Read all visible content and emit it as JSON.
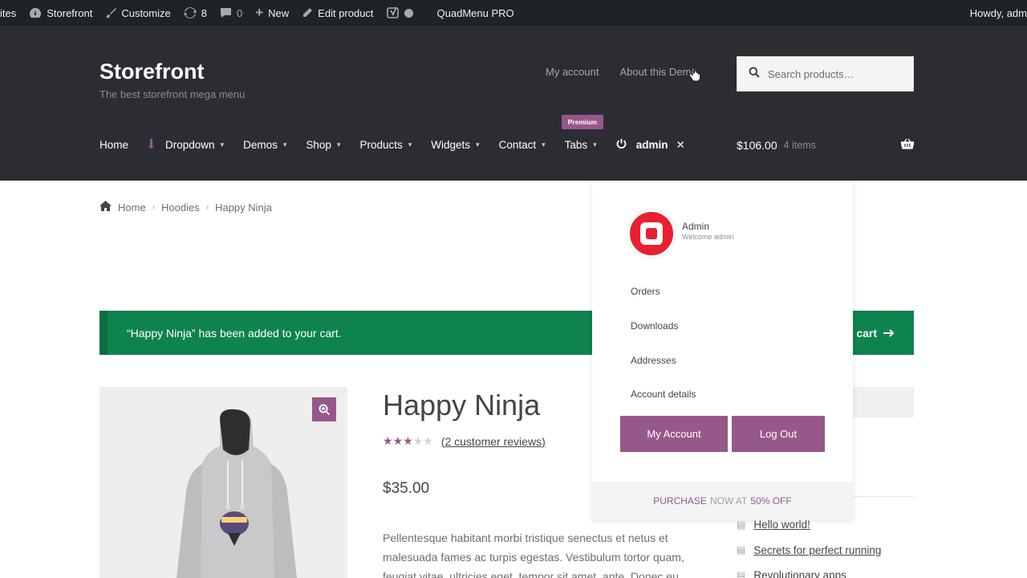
{
  "adminbar": {
    "sites": "ites",
    "site": "Storefront",
    "customize": "Customize",
    "updates_count": "8",
    "comments_count": "0",
    "new": "New",
    "edit_product": "Edit product",
    "plugin": "QuadMenu PRO",
    "howdy": "Howdy, adm"
  },
  "header": {
    "site_title": "Storefront",
    "site_description": "The best storefront mega menu",
    "secondary_nav": [
      "My account",
      "About this Demo"
    ],
    "search_placeholder": "Search products…",
    "nav": {
      "home": "Home",
      "dropdown": "Dropdown",
      "demos": "Demos",
      "shop": "Shop",
      "products": "Products",
      "widgets": "Widgets",
      "contact": "Contact",
      "tabs": "Tabs",
      "tabs_badge": "Premium",
      "admin": "admin"
    },
    "cart": {
      "total": "$106.00",
      "items": "4 items"
    }
  },
  "breadcrumb": [
    "Home",
    "Hoodies",
    "Happy Ninja"
  ],
  "notice": {
    "message": "“Happy Ninja” has been added to your cart.",
    "action": "y cart"
  },
  "product": {
    "title": "Happy Ninja",
    "rating": 3,
    "rating_max": 5,
    "reviews": "(2 customer reviews)",
    "price": "$35.00",
    "description": "Pellentesque habitant morbi tristique senectus et netus et malesuada fames ac turpis egestas. Vestibulum tortor quam, feugiat vitae, ultricies eget, tempor sit amet, ante. Donec eu"
  },
  "sidebar": {
    "posts": [
      "Hello world!",
      "Secrets for perfect running",
      "Revolutionary apps"
    ]
  },
  "account_dropdown": {
    "user_name": "Admin",
    "welcome": "Welcome admin",
    "links": [
      "Orders",
      "Downloads",
      "Addresses",
      "Account details"
    ],
    "my_account_button": "My Account",
    "logout_button": "Log Out",
    "promo_start": "PURCHASE",
    "promo_mid": "NOW AT",
    "promo_end": "50% OFF"
  },
  "colors": {
    "accent": "#96588a",
    "header_bg": "#2c2d33",
    "adminbar_bg": "#1d2327",
    "notice_bg": "#0f834d"
  }
}
